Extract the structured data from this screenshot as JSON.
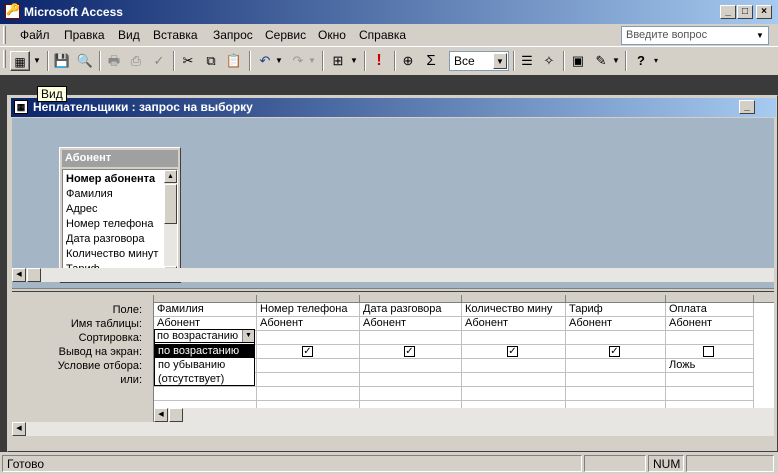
{
  "app": {
    "title": "Microsoft Access",
    "caption_buttons": [
      "_",
      "□",
      "×"
    ]
  },
  "menu": {
    "items": [
      "Файл",
      "Правка",
      "Вид",
      "Вставка",
      "Запрос",
      "Сервис",
      "Окно",
      "Справка"
    ],
    "question_placeholder": "Введите вопрос"
  },
  "toolbar": {
    "view_tooltip": "Вид",
    "top_values": "Все",
    "icons": [
      "view-icon",
      "save-icon",
      "search-icon",
      "print-icon",
      "print-preview-icon",
      "spelling-icon",
      "cut-icon",
      "copy-icon",
      "paste-icon",
      "undo-icon",
      "redo-icon",
      "query-type-icon",
      "run-icon",
      "show-table-icon",
      "totals-icon",
      "properties-icon",
      "builder-icon",
      "database-window-icon",
      "new-object-icon",
      "help-icon"
    ]
  },
  "query_window": {
    "title": "Неплательщики : запрос на выборку",
    "table": {
      "name": "Абонент",
      "fields": [
        "Номер абонента",
        "Фамилия",
        "Адрес",
        "Номер телефона",
        "Дата разговора",
        "Количество минут",
        "Тариф"
      ]
    }
  },
  "grid": {
    "row_labels": [
      "Поле:",
      "Имя таблицы:",
      "Сортировка:",
      "Вывод на экран:",
      "Условие отбора:",
      "или:"
    ],
    "columns": [
      {
        "field": "Фамилия",
        "table": "Абонент",
        "sort": "по возрастанию",
        "show": true,
        "criteria": ""
      },
      {
        "field": "Номер телефона",
        "table": "Абонент",
        "sort": "",
        "show": true,
        "criteria": ""
      },
      {
        "field": "Дата разговора",
        "table": "Абонент",
        "sort": "",
        "show": true,
        "criteria": ""
      },
      {
        "field": "Количество мину",
        "table": "Абонент",
        "sort": "",
        "show": true,
        "criteria": ""
      },
      {
        "field": "Тариф",
        "table": "Абонент",
        "sort": "",
        "show": true,
        "criteria": ""
      },
      {
        "field": "Оплата",
        "table": "Абонент",
        "sort": "",
        "show": false,
        "criteria": "Ложь"
      }
    ],
    "sort_options": [
      "по возрастанию",
      "по убыванию",
      "(отсутствует)"
    ]
  },
  "status": {
    "text": "Готово",
    "num": "NUM"
  }
}
